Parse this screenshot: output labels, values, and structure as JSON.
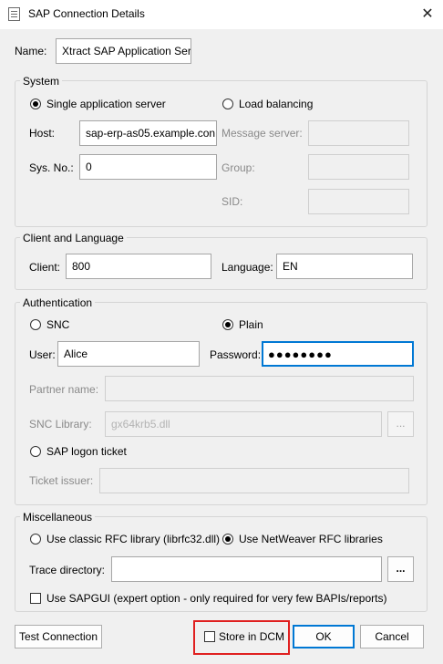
{
  "window": {
    "title": "SAP Connection Details",
    "close_glyph": "✕"
  },
  "name": {
    "label": "Name:",
    "value": "Xtract SAP Application Ser"
  },
  "system": {
    "legend": "System",
    "single_label": "Single application server",
    "load_label": "Load balancing",
    "host_label": "Host:",
    "host_value": "sap-erp-as05.example.con",
    "sysno_label": "Sys. No.:",
    "sysno_value": "0",
    "msgserver_label": "Message server:",
    "group_label": "Group:",
    "sid_label": "SID:",
    "selected": "single"
  },
  "client": {
    "legend": "Client and Language",
    "client_label": "Client:",
    "client_value": "800",
    "language_label": "Language:",
    "language_value": "EN"
  },
  "auth": {
    "legend": "Authentication",
    "snc_label": "SNC",
    "plain_label": "Plain",
    "selected": "plain",
    "user_label": "User:",
    "user_value": "Alice",
    "password_label": "Password:",
    "password_value": "●●●●●●●●",
    "partner_label": "Partner name:",
    "snclib_label": "SNC Library:",
    "snclib_value": "gx64krb5.dll",
    "browse_label": "...",
    "logon_ticket_label": "SAP logon ticket",
    "ticket_issuer_label": "Ticket issuer:"
  },
  "misc": {
    "legend": "Miscellaneous",
    "classic_label": "Use classic RFC library (librfc32.dll)",
    "netweaver_label": "Use NetWeaver RFC libraries",
    "selected": "netweaver",
    "trace_label": "Trace directory:",
    "trace_value": "",
    "browse_label": "...",
    "sapgui_label": "Use SAPGUI (expert option - only required for very few BAPIs/reports)"
  },
  "footer": {
    "test_label": "Test Connection",
    "store_label": "Store in DCM",
    "ok_label": "OK",
    "cancel_label": "Cancel"
  },
  "colors": {
    "accent": "#0078d4",
    "highlight": "#e02020"
  }
}
